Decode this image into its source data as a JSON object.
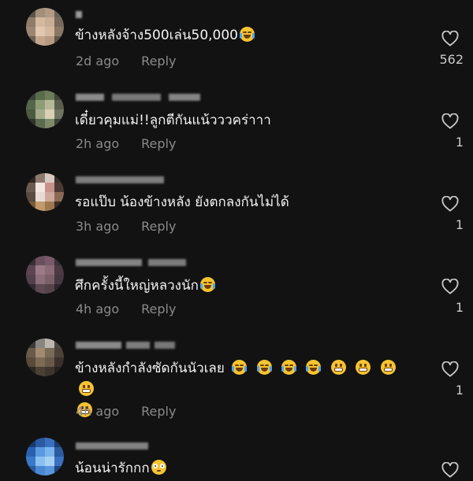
{
  "comments": [
    {
      "text": "ข้างหลังจ้าง500เล่น50,000",
      "emojis": [
        "cry"
      ],
      "time": "2d ago",
      "reply_label": "Reply",
      "likes": "562"
    },
    {
      "text": "เดี๋ยวคุมแม่!!ลูกตีกันแน้วววคร่าาา",
      "emojis": [],
      "time": "2h ago",
      "reply_label": "Reply",
      "likes": "1"
    },
    {
      "text": "รอแป๊บ น้องข้างหลัง ยังตกลงกันไม่ได้",
      "emojis": [],
      "time": "3h ago",
      "reply_label": "Reply",
      "likes": "1"
    },
    {
      "text": "ศึกครั้งนี้ใหญ่หลวงนัก",
      "emojis": [
        "cry"
      ],
      "time": "4h ago",
      "reply_label": "Reply",
      "likes": "1"
    },
    {
      "text": "ข้างหลังกำลังซัดกันนัวเลย",
      "emojis": [
        "cry",
        "cry",
        "cry",
        "cry",
        "grin",
        "grin",
        "grin",
        "grin",
        "grin"
      ],
      "time": "4h ago",
      "reply_label": "Reply",
      "likes": "1"
    },
    {
      "text": "น้อนน่ารักกก",
      "emojis": [
        "flushed"
      ],
      "time": "",
      "reply_label": "",
      "likes": ""
    }
  ],
  "colors": {
    "background": "#121212",
    "text": "#f2f2f2",
    "meta": "#8a8a8a",
    "like_count": "#c9c9c9"
  },
  "icons": {
    "like": "heart-outline-icon",
    "emoji_cry": "face-with-tears-of-joy-icon",
    "emoji_grin": "grinning-face-icon",
    "emoji_flushed": "flushed-face-icon"
  }
}
